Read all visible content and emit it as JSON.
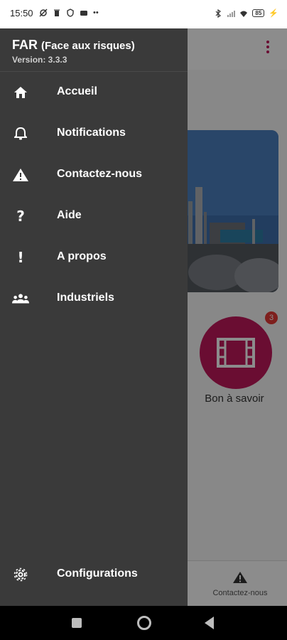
{
  "status_bar": {
    "time": "15:50",
    "battery": "85"
  },
  "drawer": {
    "title": "FAR",
    "subtitle": "(Face aux risques)",
    "version": "Version: 3.3.3",
    "items": [
      {
        "label": "Accueil",
        "icon": "home-icon"
      },
      {
        "label": "Notifications",
        "icon": "bell-icon"
      },
      {
        "label": "Contactez-nous",
        "icon": "warning-icon"
      },
      {
        "label": "Aide",
        "icon": "question-icon"
      },
      {
        "label": "A propos",
        "icon": "exclamation-icon"
      },
      {
        "label": "Industriels",
        "icon": "people-icon"
      }
    ],
    "footer_item": {
      "label": "Configurations",
      "icon": "gear-icon"
    }
  },
  "page": {
    "card": {
      "label": "Bon à savoir",
      "badge": "3",
      "icon": "film-icon"
    },
    "bottom_nav": {
      "label": "Contactez-nous",
      "icon": "warning-icon"
    }
  },
  "colors": {
    "accent": "#c2185b",
    "drawer_bg": "#3a3a3a",
    "badge": "#e53935"
  }
}
